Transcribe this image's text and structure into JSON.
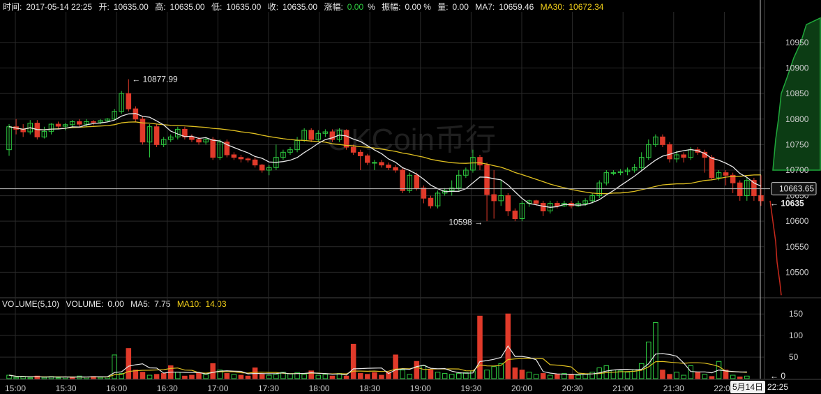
{
  "infobar": {
    "time_label": "时间:",
    "time_value": "2017-05-14 22:25",
    "open_label": "开:",
    "open_value": "10635.00",
    "high_label": "高:",
    "high_value": "10635.00",
    "low_label": "低:",
    "low_value": "10635.00",
    "close_label": "收:",
    "close_value": "10635.00",
    "change_label": "涨幅:",
    "change_value": "0.00",
    "change_unit": "%",
    "amplitude_label": "振幅:",
    "amplitude_value": "0.00 %",
    "volume_label": "量:",
    "volume_value": "0.00",
    "ma7_label": "MA7:",
    "ma7_value": "10659.46",
    "ma30_label": "MA30:",
    "ma30_value": "10672.34"
  },
  "volumebar": {
    "title": "VOLUME(5,10)",
    "volume_label": "VOLUME:",
    "volume_value": "0.00",
    "ma5_label": "MA5:",
    "ma5_value": "7.75",
    "ma10_label": "MA10:",
    "ma10_value": "14.03"
  },
  "watermark": "OKCoin币行",
  "annotations": {
    "high_label": "← 10877.99",
    "low_label": "10598 →",
    "crosshair_price": "10663.65",
    "last_price": "← 10635",
    "vol_zero": "← 0"
  },
  "badges": {
    "date": "5月14日",
    "time": "22:25"
  },
  "colors": {
    "up": "#2ecc40",
    "down": "#e03a2a",
    "ma_white": "#e6e6e6",
    "ma_yellow": "#e0c020",
    "grid": "#2a2a2a",
    "depth_bid": "#1fa83a",
    "depth_ask": "#c8291c"
  },
  "chart_data": {
    "type": "candlestick",
    "price_axis": {
      "ticks": [
        10500,
        10550,
        10600,
        10650,
        10700,
        10750,
        10800,
        10850,
        10900,
        10950
      ],
      "ylim": [
        10450,
        11010
      ]
    },
    "volume_axis": {
      "ticks": [
        0,
        50,
        100,
        150
      ],
      "ylim": [
        0,
        160
      ]
    },
    "time_axis": [
      "15:00",
      "15:30",
      "16:00",
      "16:30",
      "17:00",
      "17:30",
      "18:00",
      "18:30",
      "19:00",
      "19:30",
      "20:00",
      "20:30",
      "21:00",
      "21:30",
      "22:00"
    ],
    "candles": [
      [
        10740,
        10785,
        10728,
        10790
      ],
      [
        10785,
        10780,
        10770,
        10800
      ],
      [
        10780,
        10775,
        10765,
        10790
      ],
      [
        10775,
        10792,
        10770,
        10798
      ],
      [
        10792,
        10765,
        10760,
        10798
      ],
      [
        10765,
        10776,
        10762,
        10785
      ],
      [
        10776,
        10790,
        10770,
        10792
      ],
      [
        10790,
        10786,
        10780,
        10795
      ],
      [
        10786,
        10789,
        10778,
        10792
      ],
      [
        10789,
        10795,
        10785,
        10798
      ],
      [
        10795,
        10790,
        10785,
        10800
      ],
      [
        10790,
        10795,
        10785,
        10800
      ],
      [
        10795,
        10794,
        10788,
        10798
      ],
      [
        10794,
        10797,
        10790,
        10800
      ],
      [
        10797,
        10800,
        10795,
        10802
      ],
      [
        10800,
        10815,
        10798,
        10820
      ],
      [
        10815,
        10850,
        10810,
        10855
      ],
      [
        10850,
        10820,
        10815,
        10877.99
      ],
      [
        10820,
        10800,
        10795,
        10825
      ],
      [
        10800,
        10755,
        10750,
        10805
      ],
      [
        10755,
        10785,
        10725,
        10790
      ],
      [
        10785,
        10750,
        10745,
        10790
      ],
      [
        10750,
        10760,
        10745,
        10765
      ],
      [
        10760,
        10765,
        10755,
        10770
      ],
      [
        10765,
        10780,
        10760,
        10785
      ],
      [
        10780,
        10765,
        10760,
        10785
      ],
      [
        10765,
        10760,
        10755,
        10770
      ],
      [
        10760,
        10755,
        10750,
        10765
      ],
      [
        10755,
        10760,
        10750,
        10765
      ],
      [
        10760,
        10725,
        10720,
        10765
      ],
      [
        10725,
        10755,
        10720,
        10760
      ],
      [
        10755,
        10730,
        10725,
        10760
      ],
      [
        10730,
        10725,
        10720,
        10735
      ],
      [
        10725,
        10722,
        10715,
        10730
      ],
      [
        10722,
        10720,
        10715,
        10725
      ],
      [
        10720,
        10710,
        10705,
        10725
      ],
      [
        10710,
        10700,
        10695,
        10712
      ],
      [
        10700,
        10705,
        10690,
        10710
      ],
      [
        10705,
        10725,
        10700,
        10750
      ],
      [
        10725,
        10735,
        10720,
        10740
      ],
      [
        10735,
        10740,
        10730,
        10745
      ],
      [
        10740,
        10758,
        10735,
        10765
      ],
      [
        10758,
        10778,
        10755,
        10782
      ],
      [
        10778,
        10760,
        10755,
        10782
      ],
      [
        10760,
        10772,
        10755,
        10778
      ],
      [
        10772,
        10775,
        10765,
        10780
      ],
      [
        10775,
        10760,
        10755,
        10780
      ],
      [
        10760,
        10778,
        10755,
        10782
      ],
      [
        10778,
        10745,
        10740,
        10780
      ],
      [
        10745,
        10735,
        10730,
        10750
      ],
      [
        10735,
        10728,
        10700,
        10740
      ],
      [
        10728,
        10715,
        10710,
        10732
      ],
      [
        10715,
        10715,
        10700,
        10720
      ],
      [
        10715,
        10710,
        10705,
        10720
      ],
      [
        10710,
        10705,
        10700,
        10715
      ],
      [
        10705,
        10700,
        10695,
        10710
      ],
      [
        10700,
        10660,
        10655,
        10705
      ],
      [
        10660,
        10690,
        10655,
        10695
      ],
      [
        10690,
        10665,
        10660,
        10695
      ],
      [
        10665,
        10645,
        10635,
        10670
      ],
      [
        10645,
        10630,
        10625,
        10650
      ],
      [
        10630,
        10655,
        10625,
        10660
      ],
      [
        10655,
        10660,
        10650,
        10665
      ],
      [
        10660,
        10665,
        10650,
        10680
      ],
      [
        10665,
        10690,
        10660,
        10700
      ],
      [
        10690,
        10700,
        10685,
        10705
      ],
      [
        10700,
        10725,
        10695,
        10740
      ],
      [
        10725,
        10710,
        10700,
        10730
      ],
      [
        10710,
        10652,
        10600,
        10715
      ],
      [
        10652,
        10640,
        10605,
        10700
      ],
      [
        10640,
        10650,
        10630,
        10680
      ],
      [
        10650,
        10620,
        10610,
        10655
      ],
      [
        10620,
        10605,
        10600,
        10625
      ],
      [
        10605,
        10635,
        10600,
        10640
      ],
      [
        10635,
        10640,
        10628,
        10642
      ],
      [
        10640,
        10635,
        10630,
        10642
      ],
      [
        10635,
        10620,
        10610,
        10640
      ],
      [
        10620,
        10635,
        10615,
        10640
      ],
      [
        10635,
        10630,
        10625,
        10640
      ],
      [
        10630,
        10635,
        10628,
        10640
      ],
      [
        10635,
        10630,
        10625,
        10640
      ],
      [
        10630,
        10635,
        10628,
        10640
      ],
      [
        10635,
        10640,
        10630,
        10645
      ],
      [
        10640,
        10650,
        10635,
        10655
      ],
      [
        10650,
        10675,
        10645,
        10680
      ],
      [
        10675,
        10695,
        10670,
        10700
      ],
      [
        10695,
        10695,
        10690,
        10700
      ],
      [
        10695,
        10697,
        10690,
        10702
      ],
      [
        10697,
        10700,
        10690,
        10705
      ],
      [
        10700,
        10705,
        10695,
        10712
      ],
      [
        10705,
        10725,
        10700,
        10735
      ],
      [
        10725,
        10750,
        10720,
        10760
      ],
      [
        10750,
        10765,
        10745,
        10770
      ],
      [
        10765,
        10750,
        10745,
        10770
      ],
      [
        10750,
        10722,
        10715,
        10755
      ],
      [
        10722,
        10730,
        10715,
        10738
      ],
      [
        10730,
        10725,
        10715,
        10735
      ],
      [
        10725,
        10740,
        10720,
        10745
      ],
      [
        10740,
        10735,
        10730,
        10745
      ],
      [
        10735,
        10725,
        10695,
        10740
      ],
      [
        10725,
        10685,
        10680,
        10730
      ],
      [
        10685,
        10695,
        10680,
        10700
      ],
      [
        10695,
        10690,
        10670,
        10700
      ],
      [
        10690,
        10675,
        10655,
        10695
      ],
      [
        10675,
        10650,
        10640,
        10680
      ],
      [
        10650,
        10680,
        10640,
        10685
      ],
      [
        10680,
        10650,
        10640,
        10685
      ],
      [
        10650,
        10640,
        10630,
        10690
      ]
    ],
    "volumes": [
      [
        8,
        1
      ],
      [
        3,
        1
      ],
      [
        4,
        1
      ],
      [
        2,
        1
      ],
      [
        6,
        0
      ],
      [
        3,
        1
      ],
      [
        5,
        1
      ],
      [
        2,
        1
      ],
      [
        4,
        1
      ],
      [
        3,
        0
      ],
      [
        6,
        1
      ],
      [
        4,
        1
      ],
      [
        5,
        0
      ],
      [
        3,
        1
      ],
      [
        4,
        1
      ],
      [
        55,
        1
      ],
      [
        12,
        1
      ],
      [
        70,
        0
      ],
      [
        20,
        0
      ],
      [
        15,
        0
      ],
      [
        8,
        1
      ],
      [
        10,
        0
      ],
      [
        12,
        0
      ],
      [
        30,
        0
      ],
      [
        15,
        1
      ],
      [
        6,
        0
      ],
      [
        8,
        0
      ],
      [
        14,
        0
      ],
      [
        10,
        1
      ],
      [
        35,
        0
      ],
      [
        20,
        1
      ],
      [
        12,
        0
      ],
      [
        10,
        1
      ],
      [
        8,
        0
      ],
      [
        6,
        0
      ],
      [
        25,
        0
      ],
      [
        10,
        0
      ],
      [
        8,
        1
      ],
      [
        10,
        1
      ],
      [
        15,
        1
      ],
      [
        12,
        1
      ],
      [
        14,
        1
      ],
      [
        10,
        1
      ],
      [
        18,
        0
      ],
      [
        8,
        1
      ],
      [
        10,
        1
      ],
      [
        6,
        0
      ],
      [
        12,
        1
      ],
      [
        6,
        0
      ],
      [
        80,
        0
      ],
      [
        12,
        0
      ],
      [
        10,
        0
      ],
      [
        14,
        0
      ],
      [
        8,
        0
      ],
      [
        15,
        0
      ],
      [
        55,
        0
      ],
      [
        20,
        1
      ],
      [
        10,
        1
      ],
      [
        40,
        0
      ],
      [
        30,
        1
      ],
      [
        20,
        0
      ],
      [
        15,
        1
      ],
      [
        12,
        1
      ],
      [
        10,
        1
      ],
      [
        12,
        1
      ],
      [
        14,
        1
      ],
      [
        18,
        1
      ],
      [
        145,
        0
      ],
      [
        20,
        1
      ],
      [
        28,
        1
      ],
      [
        35,
        1
      ],
      [
        150,
        0
      ],
      [
        25,
        0
      ],
      [
        20,
        0
      ],
      [
        15,
        1
      ],
      [
        10,
        1
      ],
      [
        12,
        0
      ],
      [
        8,
        1
      ],
      [
        10,
        0
      ],
      [
        12,
        1
      ],
      [
        10,
        0
      ],
      [
        8,
        1
      ],
      [
        10,
        1
      ],
      [
        15,
        1
      ],
      [
        25,
        1
      ],
      [
        30,
        1
      ],
      [
        20,
        1
      ],
      [
        18,
        1
      ],
      [
        15,
        1
      ],
      [
        20,
        1
      ],
      [
        35,
        1
      ],
      [
        85,
        1
      ],
      [
        130,
        1
      ],
      [
        20,
        0
      ],
      [
        10,
        0
      ],
      [
        15,
        1
      ],
      [
        8,
        1
      ],
      [
        30,
        1
      ],
      [
        15,
        0
      ],
      [
        10,
        1
      ],
      [
        5,
        0
      ],
      [
        40,
        1
      ],
      [
        20,
        0
      ],
      [
        8,
        1
      ],
      [
        4,
        0
      ],
      [
        6,
        1
      ]
    ]
  }
}
